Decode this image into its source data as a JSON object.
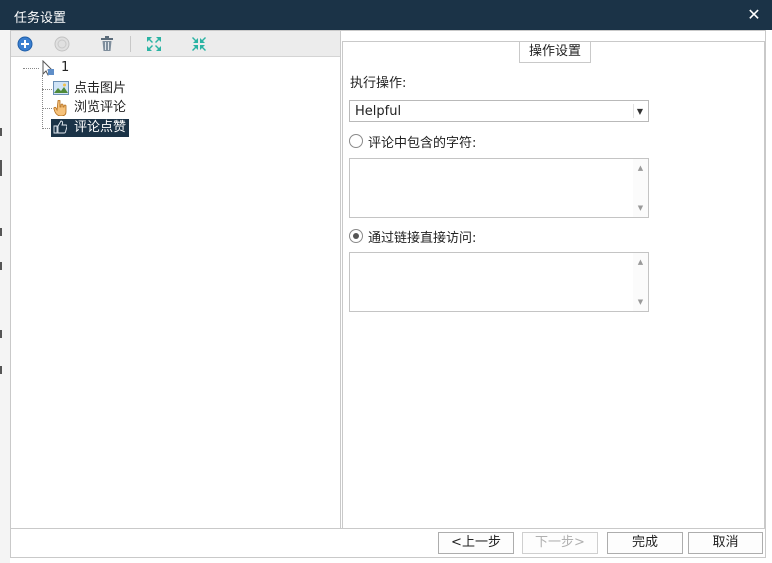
{
  "window": {
    "title": "任务设置",
    "close_label": "✕"
  },
  "toolbar": {
    "icons": [
      "add-icon",
      "disabled-circle-icon",
      "delete-icon",
      "expand-icon",
      "collapse-icon"
    ]
  },
  "tree": {
    "root": "1",
    "children": [
      "点击图片",
      "浏览评论",
      "评论点赞"
    ]
  },
  "settings": {
    "group_title": "操作设置",
    "operation_label": "执行操作:",
    "operation_value": "Helpful",
    "option_text": "评论中包含的字符:",
    "option_link": "通过链接直接访问:",
    "selected_option": "link"
  },
  "buttons": {
    "prev": "<上一步",
    "next": "下一步>",
    "finish": "完成",
    "cancel": "取消"
  },
  "colors": {
    "title_bar": "#1b3347",
    "selected": "#1b3347",
    "accent": "#2bb3a3"
  }
}
